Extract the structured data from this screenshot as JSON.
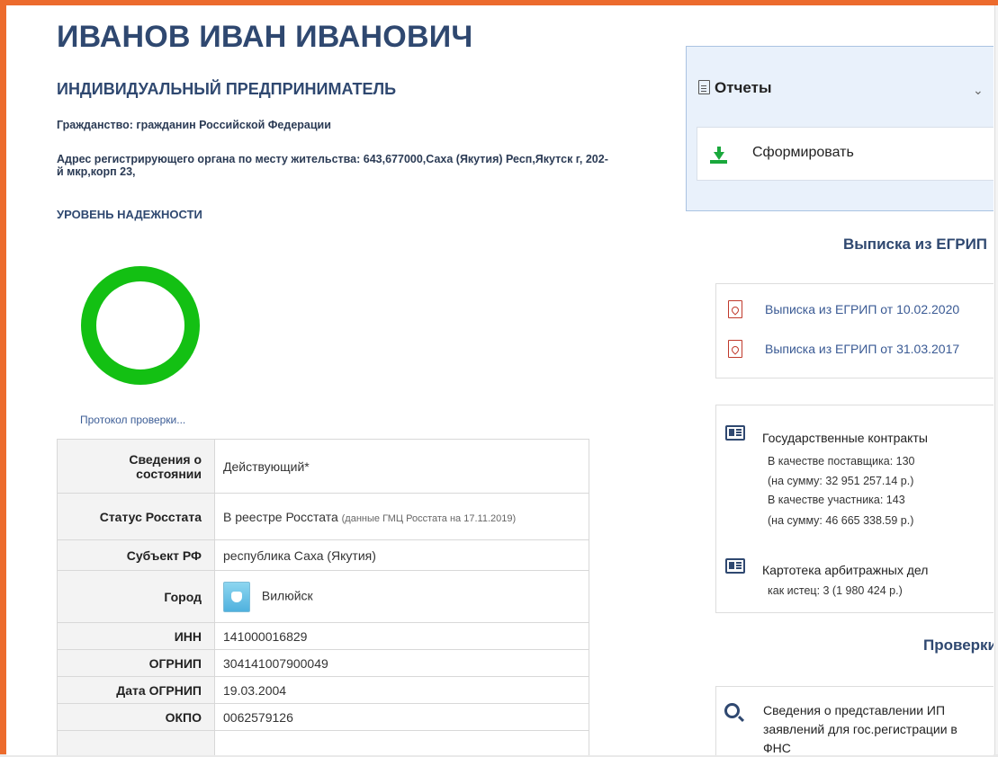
{
  "person": {
    "name": "ИВАНОВ ИВАН ИВАНОВИЧ",
    "subtitle": "ИНДИВИДУАЛЬНЫЙ ПРЕДПРИНИМАТЕЛЬ",
    "citizenship": "Гражданство: гражданин Российской Федерации",
    "address": "Адрес регистрирующего органа по месту жительства: 643,677000,Саха (Якутия) Респ,Якутск г, 202-й мкр,корп 23,"
  },
  "reliability": {
    "title": "УРОВЕНЬ НАДЕЖНОСТИ",
    "protocol_link": "Протокол проверки...",
    "ring_color": "#13c013"
  },
  "info_table": [
    {
      "key": "Сведения о состоянии",
      "value": "Действующий*",
      "note": ""
    },
    {
      "key": "Статус Росстата",
      "value": "В реестре Росстата",
      "note": "(данные ГМЦ Росстата на 17.11.2019)"
    },
    {
      "key": "Субъект РФ",
      "value": "республика Саха (Якутия)",
      "note": ""
    },
    {
      "key": "Город",
      "value": "Вилюйск",
      "note": ""
    },
    {
      "key": "ИНН",
      "value": "141000016829",
      "note": ""
    },
    {
      "key": "ОГРНИП",
      "value": "304141007900049",
      "note": ""
    },
    {
      "key": "Дата ОГРНИП",
      "value": "19.03.2004",
      "note": ""
    },
    {
      "key": "ОКПО",
      "value": "0062579126",
      "note": ""
    }
  ],
  "reports": {
    "title": "Отчеты",
    "chevron": "⌄",
    "generate_label": "Сформировать"
  },
  "egrip": {
    "title": "Выписка из ЕГРИП",
    "items": [
      {
        "label": "Выписка из ЕГРИП от 10.02.2020"
      },
      {
        "label": "Выписка из ЕГРИП от 31.03.2017"
      }
    ]
  },
  "contracts": {
    "title": "Государственные контракты",
    "supplier_line": "В качестве поставщика: 130",
    "supplier_sum": "(на сумму: 32 951 257.14 р.)",
    "participant_line": "В качестве участника: 143",
    "participant_sum": "(на сумму: 46 665 338.59 р.)"
  },
  "arbitration": {
    "title": "Картотека арбитражных дел",
    "plaintiff_line": "как истец: 3 (1 980 424 р.)"
  },
  "checks": {
    "title": "Проверки",
    "item_text": "Сведения о представлении ИП заявлений для гос.регистрации в ФНС"
  }
}
